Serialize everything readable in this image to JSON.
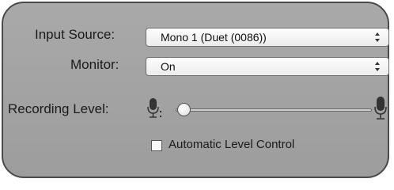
{
  "input_source": {
    "label": "Input Source:",
    "value": "Mono 1 (Duet (0086))"
  },
  "monitor": {
    "label": "Monitor:",
    "value": "On"
  },
  "recording_level": {
    "label": "Recording Level:",
    "level": 0.0,
    "min_icon": "microphone-small-icon",
    "max_icon": "microphone-large-icon"
  },
  "automatic_level_control": {
    "label": "Automatic Level Control",
    "checked": false
  }
}
